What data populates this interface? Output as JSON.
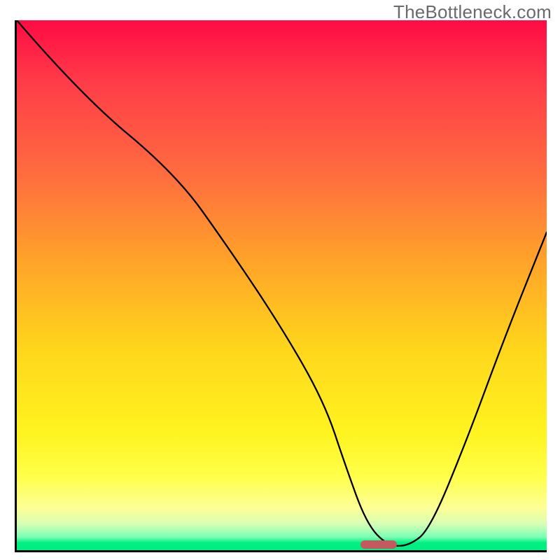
{
  "watermark": "TheBottleneck.com",
  "chart_data": {
    "type": "line",
    "title": "",
    "xlabel": "",
    "ylabel": "",
    "xlim": [
      0,
      100
    ],
    "ylim": [
      0,
      100
    ],
    "series": [
      {
        "name": "curve",
        "x": [
          0,
          12,
          30,
          40,
          50,
          58,
          62,
          66,
          70,
          74,
          78,
          85,
          92,
          100
        ],
        "y": [
          100,
          86,
          71,
          57,
          42,
          28,
          16,
          5,
          0.8,
          0.8,
          4,
          21,
          40,
          60
        ]
      }
    ],
    "marker": {
      "x_center": 68,
      "y": 1.2,
      "width_pct": 6.8
    },
    "background_gradient": {
      "stops": [
        {
          "pos": 0,
          "color": "#fe0b44"
        },
        {
          "pos": 30,
          "color": "#ff6f3e"
        },
        {
          "pos": 62,
          "color": "#ffd61c"
        },
        {
          "pos": 86,
          "color": "#ffff4a"
        },
        {
          "pos": 100,
          "color": "#00ee82"
        }
      ]
    }
  }
}
